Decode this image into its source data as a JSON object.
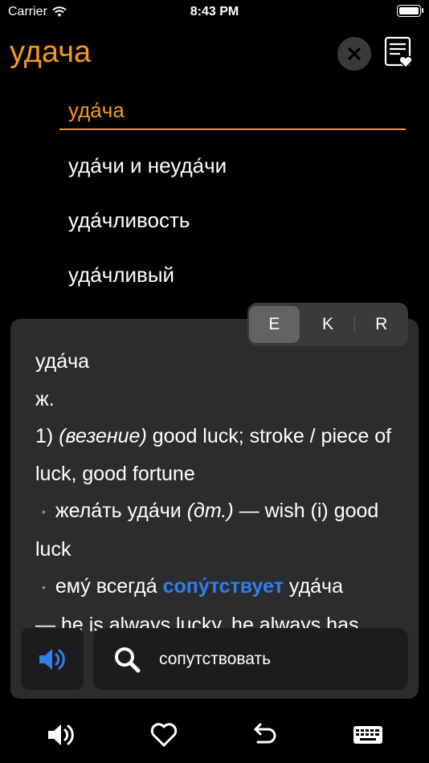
{
  "status_bar": {
    "carrier": "Carrier",
    "time": "8:43 PM"
  },
  "header": {
    "query": "удача"
  },
  "suggestions": [
    {
      "text": "уда́ча",
      "selected": true
    },
    {
      "text": "уда́чи и неуда́чи",
      "selected": false
    },
    {
      "text": "уда́чливость",
      "selected": false
    },
    {
      "text": "уда́чливый",
      "selected": false
    }
  ],
  "language_tabs": [
    "E",
    "K",
    "R"
  ],
  "active_language": "E",
  "entry": {
    "headword": "уда́ча",
    "gender": "ж.",
    "sense_number": "1)",
    "sense_note": "(везение)",
    "sense_translation": " good luck; stroke / piece of luck, good fortune",
    "ex1_ru": "жела́ть уда́чи ",
    "ex1_note": "(дт.)",
    "ex1_en": " — wish (i) good luck",
    "ex2_pre": "ему́ всегда́ ",
    "ex2_link": "сопу́тствует",
    "ex2_post": " уда́ча",
    "ex2_en": "— he is always lucky, he always has"
  },
  "search_bar": {
    "query": "сопутствовать"
  },
  "colors": {
    "accent": "#f29a1e",
    "link": "#2f7ff0",
    "card": "#2c2c2e"
  }
}
